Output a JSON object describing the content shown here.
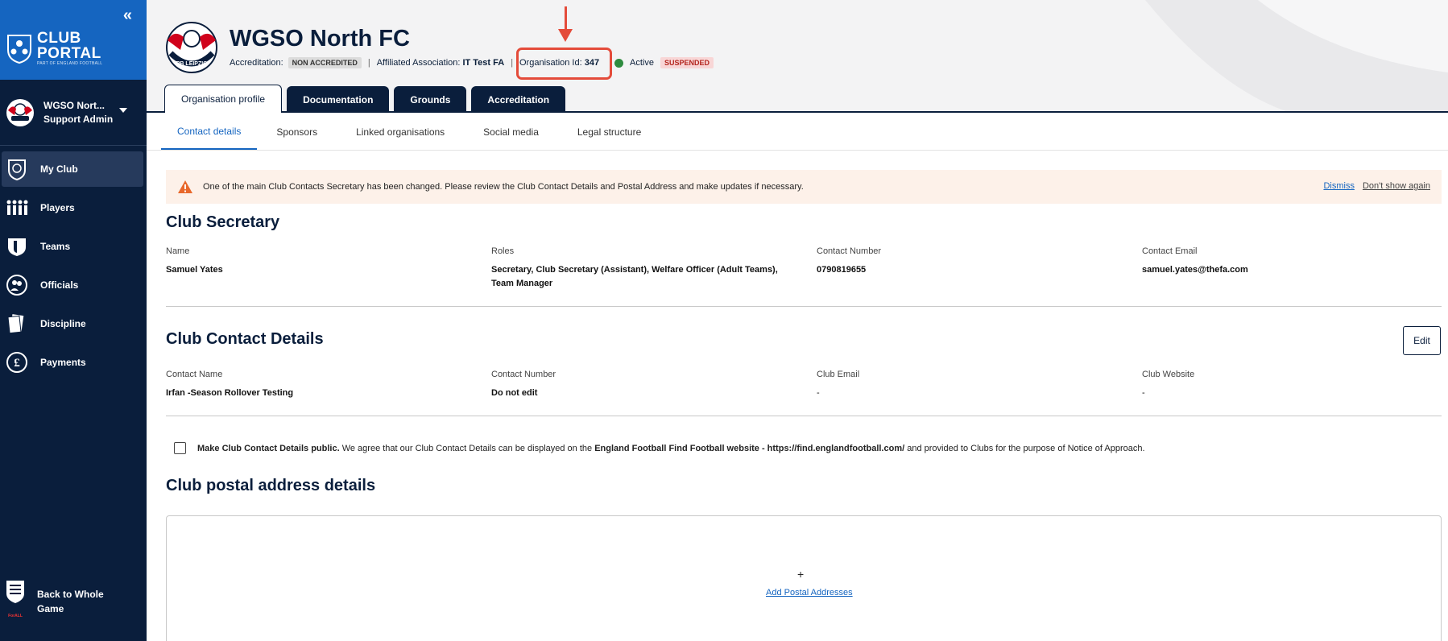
{
  "sidebar": {
    "collapse_icon": "double-chevron-left-icon",
    "portal_title_line1": "CLUB",
    "portal_title_line2": "PORTAL",
    "portal_subtitle": "PART OF ENGLAND FOOTBALL",
    "user": {
      "name": "WGSO Nort...",
      "role": "Support Admin"
    },
    "nav": [
      {
        "label": "My Club",
        "icon": "shield-icon",
        "active": true
      },
      {
        "label": "Players",
        "icon": "players-icon",
        "active": false
      },
      {
        "label": "Teams",
        "icon": "team-shirt-icon",
        "active": false
      },
      {
        "label": "Officials",
        "icon": "officials-icon",
        "active": false
      },
      {
        "label": "Discipline",
        "icon": "cards-icon",
        "active": false
      },
      {
        "label": "Payments",
        "icon": "pound-icon",
        "active": false
      }
    ],
    "back_label_line1": "Back to Whole",
    "back_label_line2": "Game",
    "fa_logo_text": "ForALL"
  },
  "header": {
    "club_name": "WGSO North FC",
    "accreditation_label": "Accreditation:",
    "accreditation_badge": "NON ACCREDITED",
    "separator": "|",
    "affiliated_label": "Affiliated Association:",
    "affiliated_value": "IT Test FA",
    "org_id_label": "Organisation Id:",
    "org_id_value": "347",
    "status_label": "Active",
    "status_badge": "SUSPENDED",
    "crest_text": "RB LEIPZIG"
  },
  "tabs": [
    {
      "label": "Organisation profile",
      "active": true
    },
    {
      "label": "Documentation",
      "active": false
    },
    {
      "label": "Grounds",
      "active": false
    },
    {
      "label": "Accreditation",
      "active": false
    }
  ],
  "subtabs": [
    {
      "label": "Contact details",
      "active": true
    },
    {
      "label": "Sponsors",
      "active": false
    },
    {
      "label": "Linked organisations",
      "active": false
    },
    {
      "label": "Social media",
      "active": false
    },
    {
      "label": "Legal structure",
      "active": false
    }
  ],
  "alert": {
    "message": "One of the main Club Contacts Secretary has been changed. Please review the Club Contact Details and Postal Address and make updates if necessary.",
    "dismiss": "Dismiss",
    "dont_show": "Don't show again"
  },
  "secretary": {
    "title": "Club Secretary",
    "name_label": "Name",
    "name_value": "Samuel Yates",
    "roles_label": "Roles",
    "roles_value": "Secretary,  Club Secretary (Assistant),  Welfare Officer (Adult Teams),",
    "roles_value_line2": "Team Manager",
    "number_label": "Contact Number",
    "number_value": "0790819655",
    "email_label": "Contact Email",
    "email_value": "samuel.yates@thefa.com"
  },
  "contact": {
    "title": "Club Contact Details",
    "edit": "Edit",
    "name_label": "Contact Name",
    "name_value": "Irfan -Season Rollover Testing",
    "number_label": "Contact Number",
    "number_value": "Do not edit",
    "email_label": "Club Email",
    "email_value": "-",
    "website_label": "Club Website",
    "website_value": "-"
  },
  "consent": {
    "bold_lead": "Make Club Contact Details public.",
    "text1": " We agree that our Club Contact Details can be displayed on the ",
    "bold_site": "England Football Find Football website - https://find.englandfootball.com/",
    "text2": " and provided to Clubs for the purpose of Notice of Approach."
  },
  "postal": {
    "title": "Club postal address details",
    "plus": "+",
    "add_label": "Add Postal Addresses"
  },
  "colors": {
    "navy": "#0a1e3c",
    "blue": "#1565c0",
    "annotation_red": "#e44b3a",
    "active_green": "#2e8b3e"
  }
}
